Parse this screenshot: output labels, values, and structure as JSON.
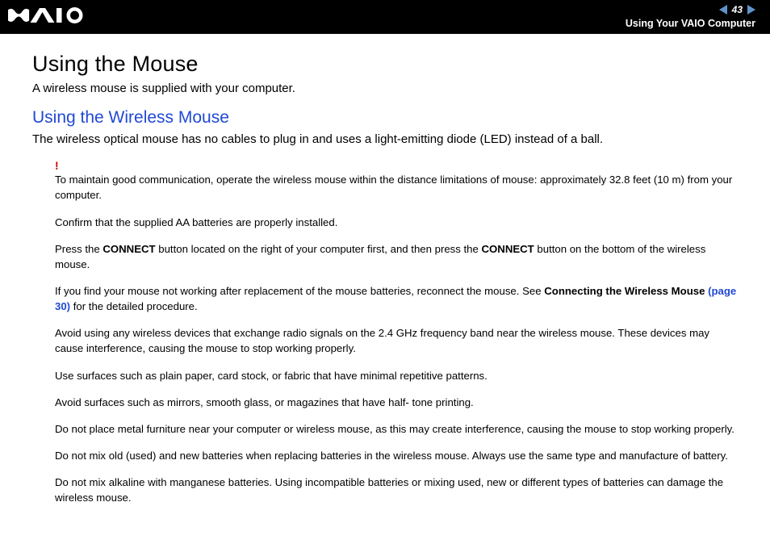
{
  "header": {
    "page_number": "43",
    "breadcrumb": "Using Your VAIO Computer"
  },
  "title": "Using the Mouse",
  "intro": "A wireless mouse is supplied with your computer.",
  "subtitle": "Using the Wireless Mouse",
  "description": "The wireless optical mouse has no cables to plug in and uses a light-emitting diode (LED) instead of a ball.",
  "exclaim": "!",
  "notes": {
    "n1": "To maintain good communication, operate the wireless mouse within the distance limitations of mouse: approximately 32.8 feet (10 m) from your computer.",
    "n2": "Confirm that the supplied AA batteries are properly installed.",
    "n3a": "Press the ",
    "n3b": "CONNECT",
    "n3c": " button located on the right of your computer first, and then press the ",
    "n3d": "CONNECT",
    "n3e": " button on the bottom of the wireless mouse.",
    "n4a": "If you find your mouse not working after replacement of the mouse batteries, reconnect the mouse. See ",
    "n4b": "Connecting the Wireless Mouse ",
    "n4c": "(page 30)",
    "n4d": " for the detailed procedure.",
    "n5": "Avoid using any wireless devices that exchange radio signals on the 2.4 GHz frequency band near the wireless mouse. These devices may cause interference, causing the mouse to stop working properly.",
    "n6": "Use surfaces such as plain paper, card stock, or fabric that have minimal repetitive patterns.",
    "n7": "Avoid surfaces such as mirrors, smooth glass, or magazines that have half- tone printing.",
    "n8": "Do not place metal furniture near your computer or wireless mouse, as this may create interference, causing the mouse to stop working properly.",
    "n9": "Do not mix old (used) and new batteries when replacing batteries in the wireless mouse. Always use the same type and manufacture of battery.",
    "n10": "Do not mix alkaline with manganese batteries. Using incompatible batteries or mixing used, new or different types of batteries can damage the wireless mouse."
  }
}
